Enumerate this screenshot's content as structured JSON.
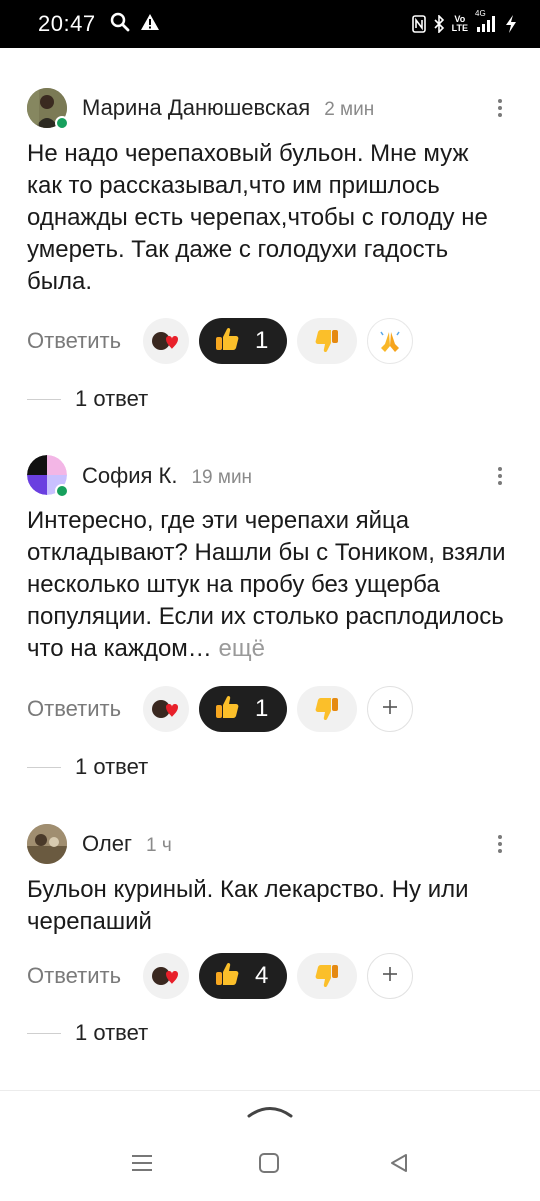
{
  "status_bar": {
    "time": "20:47",
    "icons": [
      "search-icon",
      "warning-icon",
      "nfc-icon",
      "bluetooth-icon",
      "volte-icon",
      "signal-icon",
      "charging-icon"
    ],
    "volte_top": "Vo",
    "volte_bottom": "LTE",
    "network": "4G"
  },
  "comments": [
    {
      "author": "Марина Данюшевская",
      "time": "2 мин",
      "text": "Не надо черепаховый бульон. Мне муж как то рассказывал,что им пришлось однажды есть черепах,чтобы с голоду не умереть. Так даже с голодухи гадость была.",
      "reply_label": "Ответить",
      "likes": "1",
      "replies": "1 ответ"
    },
    {
      "author": "София К.",
      "time": "19 мин",
      "text": "Интересно, где эти черепахи яйца откладывают? Нашли бы с Тоником, взяли несколько штук на пробу без ущерба популяции. Если их столько расплодилось что на каждом…",
      "more": "ещё",
      "reply_label": "Ответить",
      "likes": "1",
      "replies": "1 ответ"
    },
    {
      "author": "Олег",
      "time": "1 ч",
      "text": "Бульон куриный. Как лекарство. Ну или черепаший",
      "reply_label": "Ответить",
      "likes": "4",
      "replies": "1 ответ"
    }
  ],
  "colors": {
    "online": "#17a05d",
    "active_reaction": "#1f1f1f",
    "muted_text": "#7a7a7a"
  }
}
